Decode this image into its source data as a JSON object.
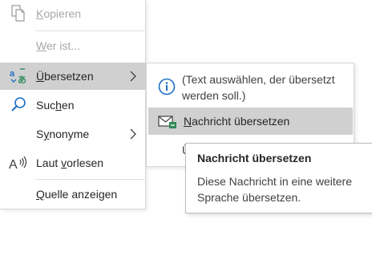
{
  "context_menu": {
    "items": [
      {
        "name": "copy",
        "label_pre": "",
        "label_u": "K",
        "label_post": "opieren",
        "disabled": true,
        "icon": "copy-icon"
      },
      {
        "name": "who-is",
        "label_pre": "",
        "label_u": "W",
        "label_post": "er ist...",
        "disabled": true,
        "icon": ""
      },
      {
        "name": "translate",
        "label_pre": "",
        "label_u": "Ü",
        "label_post": "bersetzen",
        "disabled": false,
        "icon": "translate-icon",
        "submenu": true
      },
      {
        "name": "search",
        "label_pre": "Suc",
        "label_u": "h",
        "label_post": "en",
        "disabled": false,
        "icon": "search-icon"
      },
      {
        "name": "synonyms",
        "label_pre": "S",
        "label_u": "y",
        "label_post": "nonyme",
        "disabled": false,
        "icon": "",
        "submenu": true
      },
      {
        "name": "read-aloud",
        "label_pre": "Laut ",
        "label_u": "v",
        "label_post": "orlesen",
        "disabled": false,
        "icon": "read-aloud-icon"
      },
      {
        "name": "show-source",
        "label_pre": "",
        "label_u": "Q",
        "label_post": "uelle anzeigen",
        "disabled": false,
        "icon": ""
      }
    ]
  },
  "translate_submenu": {
    "info_text": "(Text auswählen, der übersetzt werden soll.)",
    "item": {
      "label_pre": "",
      "label_u": "N",
      "label_post": "achricht übersetzen"
    },
    "partial_item_text": "Ü"
  },
  "tooltip": {
    "title": "Nachricht übersetzen",
    "body": "Diese Nachricht in eine weitere Sprache übersetzen."
  },
  "colors": {
    "highlight": "#d0d0d0",
    "info_icon": "#1e6fc6",
    "translate_icon_blue": "#1e6fc6",
    "translate_icon_green": "#2e8b57"
  }
}
